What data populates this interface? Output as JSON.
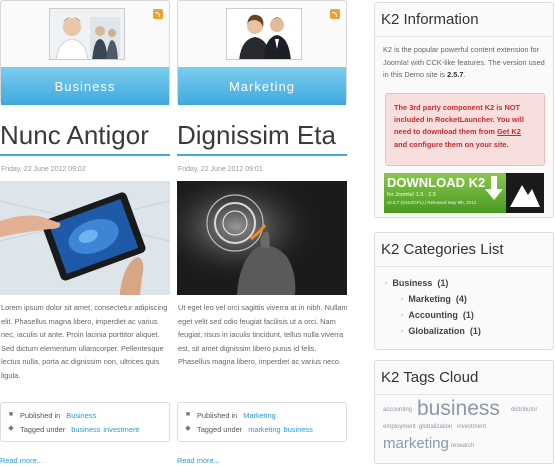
{
  "columns": [
    {
      "category": "Business",
      "title": "Nunc Antigor",
      "date": "Friday, 22 June 2012 09:02",
      "text": "Lorem ipsum dolor sit amet, consectetur adipiscing elit. Phasellus magna libero, imperdiet ac varius nec, iaculis ut ante. Proin lacinia porttitor aliquet. Sed dictum elementum ullamcorper. Pellentesque lectus nulla, porta ac dignissim non, ultrices quis ligula.",
      "published_label": "Published in",
      "published_cat": "Business",
      "tagged_label": "Tagged under",
      "tags": [
        "business",
        "investment"
      ],
      "read_more": "Read more..."
    },
    {
      "category": "Marketing",
      "title": "Dignissim Eta",
      "date": "Friday, 22 June 2012 09:01",
      "text": "Ut eget leo vel orci sagittis viverra at in nibh. Nullam eget velit sed odio feugiat facilisis ut a orci. Nam feugiat, risus in iaculis tincidunt, tellus nulla viverra est, sit amet dignissim libero purus id felis. Phasellus magna libero, imperdiet ac varius neco.",
      "published_label": "Published in",
      "published_cat": "Marketing",
      "tagged_label": "Tagged under",
      "tags": [
        "marketing",
        "business"
      ],
      "read_more": "Read more..."
    }
  ],
  "k2_info": {
    "title": "K2 Information",
    "text_a": "K2 is the popular powerful content extension for Joomla! with CCK-like features. The version used in this Demo site is ",
    "version": "2.5.7",
    "text_b": ".",
    "warn_a": "The 3rd party component K2 is NOT included in RocketLauncher. You will need to download them from ",
    "warn_link": "Get K2",
    "warn_b": " and configure them on your site.",
    "banner_title": "DOWNLOAD K2",
    "banner_sub": "for Joomla! 1.5 - 2.5",
    "banner_sub2": "v2.5.7 (GNU/GPL) | Released May 9th, 2012"
  },
  "k2_categories": {
    "title": "K2 Categories List",
    "items": [
      {
        "name": "Business",
        "count": "(1)"
      },
      {
        "name": "Marketing",
        "count": "(4)"
      },
      {
        "name": "Accounting",
        "count": "(1)"
      },
      {
        "name": "Globalization",
        "count": "(1)"
      }
    ]
  },
  "k2_tags": {
    "title": "K2 Tags Cloud",
    "tags": [
      "accounting",
      "business",
      "distributor",
      "employment",
      "globalization",
      "investment",
      "marketing",
      "research"
    ]
  },
  "colors": {
    "accent": "#3fa9dc",
    "link": "#2a9ad4",
    "warning": "#c03030",
    "banner_green": "#6ab23a"
  }
}
